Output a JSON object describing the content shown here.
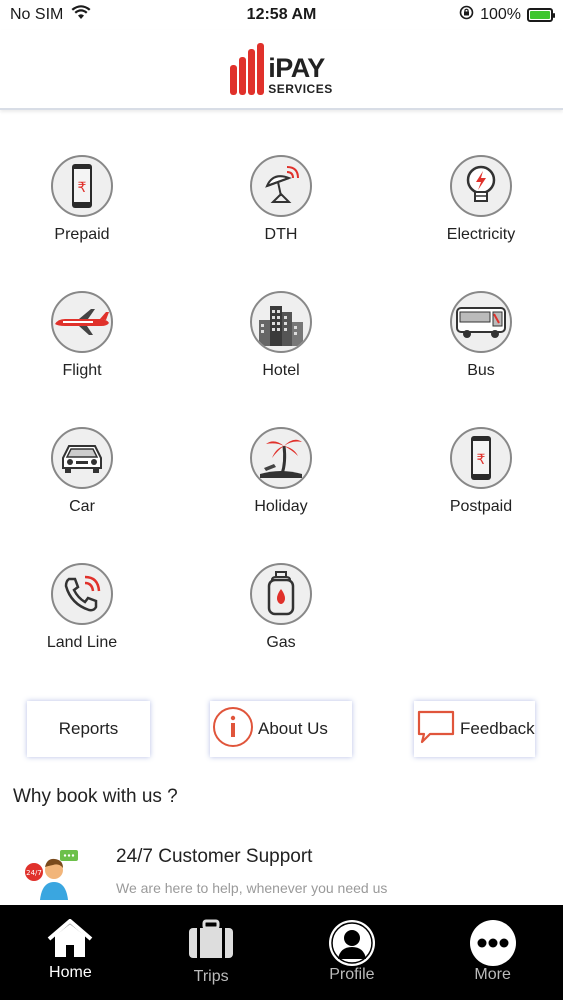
{
  "status_bar": {
    "carrier": "No SIM",
    "time": "12:58 AM",
    "battery": "100%"
  },
  "header": {
    "logo_main": "iPAY",
    "logo_sub": "SERVICES"
  },
  "services": [
    {
      "label": "Prepaid",
      "icon": "mobile-rupee-icon"
    },
    {
      "label": "DTH",
      "icon": "satellite-dish-icon"
    },
    {
      "label": "Electricity",
      "icon": "bulb-bolt-icon"
    },
    {
      "label": "Flight",
      "icon": "airplane-icon"
    },
    {
      "label": "Hotel",
      "icon": "hotel-building-icon"
    },
    {
      "label": "Bus",
      "icon": "bus-icon"
    },
    {
      "label": "Car",
      "icon": "car-icon"
    },
    {
      "label": "Holiday",
      "icon": "palm-tree-icon"
    },
    {
      "label": "Postpaid",
      "icon": "mobile-rupee-icon"
    },
    {
      "label": "Land Line",
      "icon": "phone-icon"
    },
    {
      "label": "Gas",
      "icon": "gas-cylinder-icon"
    }
  ],
  "actions": {
    "reports": "Reports",
    "about": "About Us",
    "feedback": "Feedback"
  },
  "why": {
    "title": "Why book with us ?",
    "support_title": "24/7 Customer Support",
    "support_sub": "We are here to help, whenever you need us",
    "badge": "24/7"
  },
  "tabs": {
    "home": "Home",
    "trips": "Trips",
    "profile": "Profile",
    "more": "More"
  },
  "colors": {
    "brand_red": "#e0312b",
    "tab_bg": "#000000",
    "card_shadow": "#5a6ec8"
  }
}
